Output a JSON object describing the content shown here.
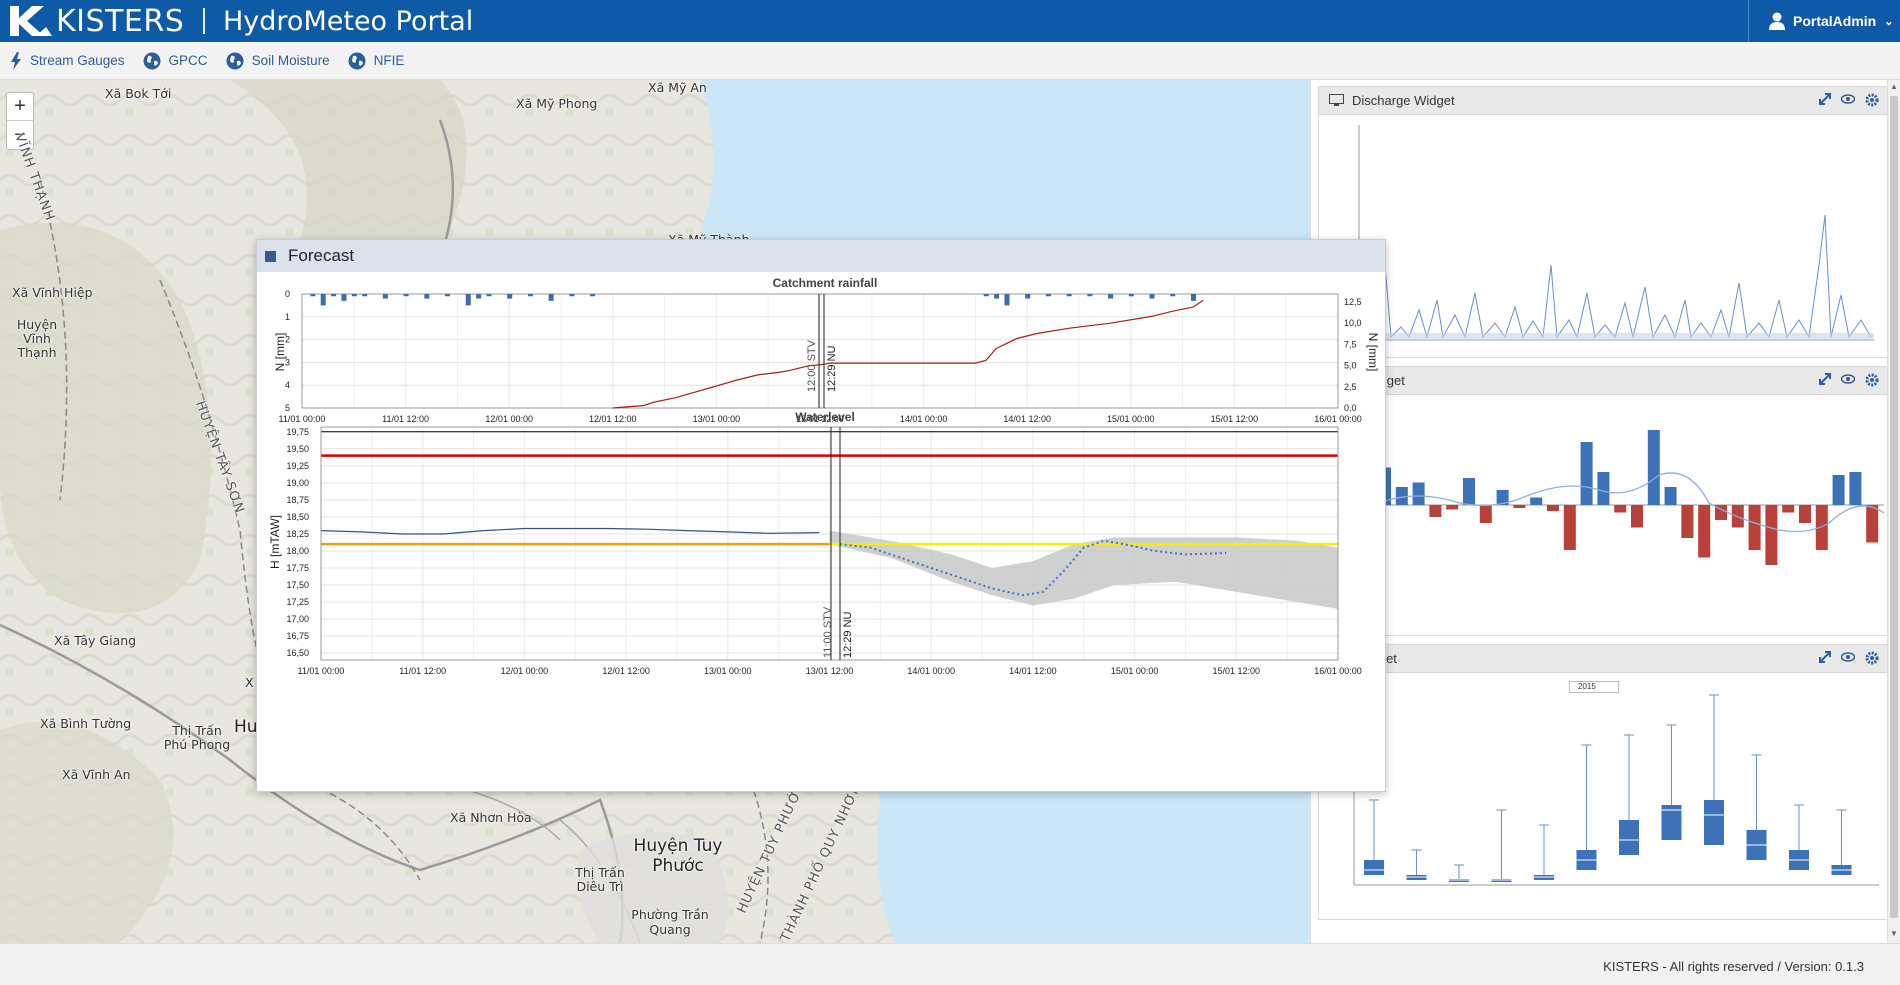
{
  "header": {
    "logo_text": "KISTERS",
    "portal_title": "HydroMeteo Portal",
    "user": "PortalAdmin"
  },
  "toolbar": {
    "items": [
      {
        "label": "Stream Gauges",
        "icon": "lightning-icon"
      },
      {
        "label": "GPCC",
        "icon": "globe-icon"
      },
      {
        "label": "Soil Moisture",
        "icon": "globe-icon"
      },
      {
        "label": "NFIE",
        "icon": "globe-icon"
      }
    ]
  },
  "map": {
    "zoom_in": "+",
    "zoom_out": "−",
    "labels": [
      "Xã Bok Tới",
      "Xã Mỹ An",
      "Xã Mỹ Phong",
      "Xã Vĩnh Hiệp",
      "Huyện Vĩnh Thạnh",
      "Xã Tây Giang",
      "Xã Bình Tường",
      "Thị Trấn Phú Phong",
      "Xã Vĩnh An",
      "Xã Nhơn Hòa",
      "Huyện Tuy Phước",
      "Thị Trấn Diêu Trì",
      "Phường Trần Quang",
      "HUYỆN TÂY SƠN",
      "VĨNH THẠNH",
      "HUYỆN TUY PHƯỚC",
      "THÀNH PHỐ QUY NHƠN",
      "Xã Mỹ Thành",
      "Hu",
      "X"
    ]
  },
  "forecast": {
    "title": "Forecast",
    "rain_title": "Catchment rainfall",
    "rain_ylabel": "N [mm]",
    "rain_ylabel_right": "N [mm]",
    "wl_title": "Waterlevel",
    "wl_ylabel": "H [mTAW]",
    "marker1": "12:00 STV",
    "marker2": "12:29 NU",
    "marker3": "11:00 STV",
    "marker4": "12:29 NU"
  },
  "widgets": {
    "discharge_title": "Discharge Widget",
    "durations_title": "urves Widget",
    "level_title": "evel Widget",
    "level_year": "2015"
  },
  "footer": {
    "text": "KISTERS - All rights reserved / Version: 0.1.3"
  },
  "chart_data": [
    {
      "type": "bar",
      "title": "Catchment rainfall",
      "ylabel": "N [mm]",
      "y2label": "N [mm]",
      "ylim": [
        5,
        0
      ],
      "y2lim": [
        0,
        12.5
      ],
      "x_ticks": [
        "11/01 00:00",
        "11/01 12:00",
        "12/01 00:00",
        "12/01 12:00",
        "13/01 00:00",
        "13/01 12:00",
        "14/01 00:00",
        "14/01 12:00",
        "15/01 00:00",
        "15/01 12:00",
        "16/01 00:00"
      ],
      "y_ticks": [
        "0",
        "1",
        "2",
        "3",
        "4",
        "5"
      ],
      "y2_ticks": [
        "12,5",
        "10,0",
        "7,5",
        "5,0",
        "2,5",
        "0,0"
      ],
      "series": [
        {
          "kind": "bar",
          "color": "#3c6eae",
          "x": [
            11.05,
            11.1,
            11.15,
            11.2,
            11.25,
            11.3,
            11.4,
            11.5,
            11.6,
            11.7,
            11.8,
            11.85,
            11.9,
            12.0,
            12.1,
            12.2,
            12.3,
            12.4,
            14.3,
            14.35,
            14.4,
            14.5,
            14.6,
            14.7,
            14.8,
            14.9,
            15.0,
            15.1,
            15.2,
            15.3
          ],
          "values": [
            0.1,
            0.5,
            0.1,
            0.3,
            0.1,
            0.1,
            0.2,
            0.1,
            0.2,
            0.1,
            0.5,
            0.2,
            0.1,
            0.2,
            0.1,
            0.3,
            0.1,
            0.1,
            0.1,
            0.2,
            0.5,
            0.2,
            0.1,
            0.1,
            0.1,
            0.2,
            0.1,
            0.2,
            0.1,
            0.3
          ]
        },
        {
          "kind": "cumulative-line",
          "color": "#a02020",
          "x": [
            12.5,
            12.65,
            12.7,
            12.8,
            12.9,
            13.0,
            13.1,
            13.2,
            13.3,
            13.35,
            13.4,
            13.45,
            13.5,
            13.55,
            13.6,
            13.8,
            14.0,
            14.1,
            14.25,
            14.3,
            14.35,
            14.45,
            14.55,
            14.7,
            14.9,
            15.1,
            15.2,
            15.3,
            15.35
          ],
          "values": [
            0,
            0.3,
            0.7,
            1.2,
            1.9,
            2.6,
            3.3,
            3.9,
            4.2,
            4.4,
            4.7,
            5.0,
            5.1,
            5.3,
            5.3,
            5.3,
            5.3,
            5.3,
            5.3,
            5.6,
            7.0,
            8.2,
            8.8,
            9.4,
            10.0,
            10.8,
            11.4,
            11.9,
            12.7
          ]
        }
      ]
    },
    {
      "type": "line",
      "title": "Waterlevel",
      "ylabel": "H [mTAW]",
      "ylim": [
        16.4,
        19.8
      ],
      "x_ticks": [
        "11/01 00:00",
        "11/01 12:00",
        "12/01 00:00",
        "12/01 12:00",
        "13/01 00:00",
        "13/01 12:00",
        "14/01 00:00",
        "14/01 12:00",
        "15/01 00:00",
        "15/01 12:00",
        "16/01 00:00"
      ],
      "y_ticks": [
        "19,75",
        "19,50",
        "19,25",
        "19,00",
        "18,75",
        "18,50",
        "18,25",
        "18,00",
        "17,75",
        "17,50",
        "17,25",
        "17,00",
        "16,75",
        "16,50"
      ],
      "thresholds": [
        {
          "value": 19.75,
          "color": "#000000"
        },
        {
          "value": 19.4,
          "color": "#d80000"
        },
        {
          "value": 18.1,
          "color": "#f0a000",
          "to_x": 13.5
        },
        {
          "value": 18.1,
          "color": "#f4f000",
          "from_x": 13.5
        }
      ],
      "series": [
        {
          "name": "observed",
          "color": "#33508c",
          "x": [
            11.0,
            11.2,
            11.4,
            11.6,
            11.8,
            12.0,
            12.2,
            12.4,
            12.6,
            12.8,
            13.0,
            13.2,
            13.45
          ],
          "values": [
            18.3,
            18.28,
            18.25,
            18.25,
            18.3,
            18.33,
            18.33,
            18.33,
            18.32,
            18.3,
            18.28,
            18.26,
            18.27
          ]
        },
        {
          "name": "forecast",
          "color": "#3a72c0",
          "dashed": true,
          "x": [
            13.55,
            13.7,
            13.9,
            14.1,
            14.3,
            14.45,
            14.55,
            14.65,
            14.75,
            14.85,
            14.95,
            15.1,
            15.25,
            15.45
          ],
          "values": [
            18.1,
            18.05,
            17.85,
            17.65,
            17.45,
            17.35,
            17.4,
            17.7,
            18.05,
            18.15,
            18.1,
            18.0,
            17.95,
            17.97
          ]
        },
        {
          "name": "band_upper",
          "color": "#c8c8c8",
          "x": [
            13.5,
            13.8,
            14.1,
            14.3,
            14.5,
            14.7,
            14.9,
            15.2,
            15.5,
            15.8,
            16.0
          ],
          "values": [
            18.3,
            18.15,
            17.95,
            17.75,
            17.85,
            18.1,
            18.2,
            18.2,
            18.2,
            18.15,
            18.05
          ]
        },
        {
          "name": "band_lower",
          "color": "#c8c8c8",
          "x": [
            13.5,
            13.8,
            14.1,
            14.3,
            14.5,
            14.7,
            14.9,
            15.2,
            15.5,
            15.8,
            16.0
          ],
          "values": [
            18.1,
            17.9,
            17.55,
            17.35,
            17.2,
            17.3,
            17.5,
            17.55,
            17.4,
            17.25,
            17.15
          ]
        }
      ]
    }
  ]
}
